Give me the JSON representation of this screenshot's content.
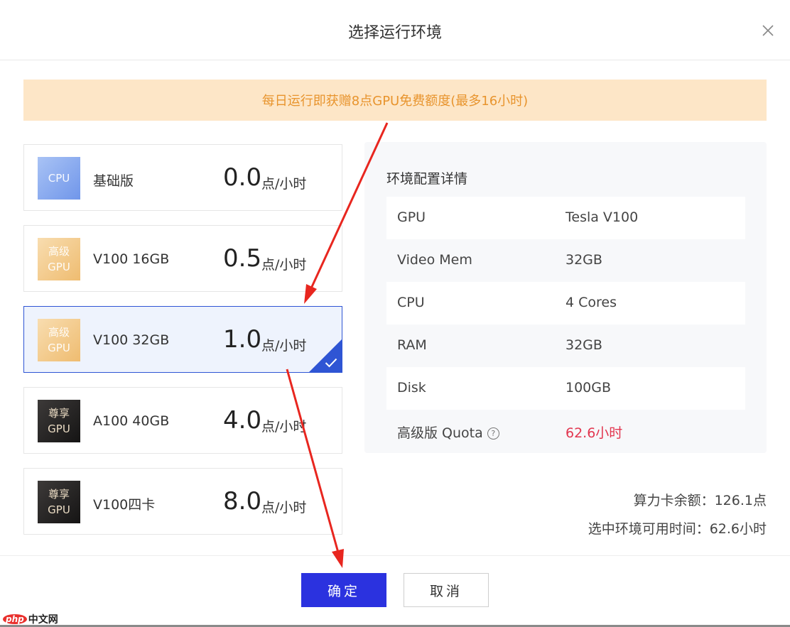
{
  "dialog": {
    "title": "选择运行环境",
    "close_icon": "close-icon"
  },
  "notice": "每日运行即获赠8点GPU免费额度(最多16小时)",
  "plans": [
    {
      "badge_line1": "CPU",
      "badge_line2": "",
      "badge_style": "blue",
      "name": "基础版",
      "price": "0.0",
      "unit": "点/小时",
      "selected": false
    },
    {
      "badge_line1": "高级",
      "badge_line2": "GPU",
      "badge_style": "gold",
      "name": "V100 16GB",
      "price": "0.5",
      "unit": "点/小时",
      "selected": false
    },
    {
      "badge_line1": "高级",
      "badge_line2": "GPU",
      "badge_style": "gold",
      "name": "V100 32GB",
      "price": "1.0",
      "unit": "点/小时",
      "selected": true
    },
    {
      "badge_line1": "尊享",
      "badge_line2": "GPU",
      "badge_style": "dark",
      "name": "A100 40GB",
      "price": "4.0",
      "unit": "点/小时",
      "selected": false
    },
    {
      "badge_line1": "尊享",
      "badge_line2": "GPU",
      "badge_style": "dark",
      "name": "V100四卡",
      "price": "8.0",
      "unit": "点/小时",
      "selected": false
    }
  ],
  "detail": {
    "title": "环境配置详情",
    "rows": [
      {
        "label": "GPU",
        "value": "Tesla V100"
      },
      {
        "label": "Video Mem",
        "value": "32GB"
      },
      {
        "label": "CPU",
        "value": "4 Cores"
      },
      {
        "label": "RAM",
        "value": "32GB"
      },
      {
        "label": "Disk",
        "value": "100GB"
      },
      {
        "label": "高级版 Quota",
        "value": "62.6小时"
      }
    ],
    "quota_help": "?"
  },
  "summary": {
    "balance": "算力卡余额：126.1点",
    "available_time": "选中环境可用时间：62.6小时"
  },
  "buttons": {
    "confirm": "确定",
    "cancel": "取消"
  },
  "watermark": {
    "logo": "php",
    "text": "中文网"
  },
  "colors": {
    "primary": "#2b32df",
    "selected_border": "#2f55d4",
    "notice_bg": "#fde6c7",
    "notice_text": "#e8942d",
    "quota_value": "#e2364f",
    "annotation_arrow": "#e8261f"
  }
}
